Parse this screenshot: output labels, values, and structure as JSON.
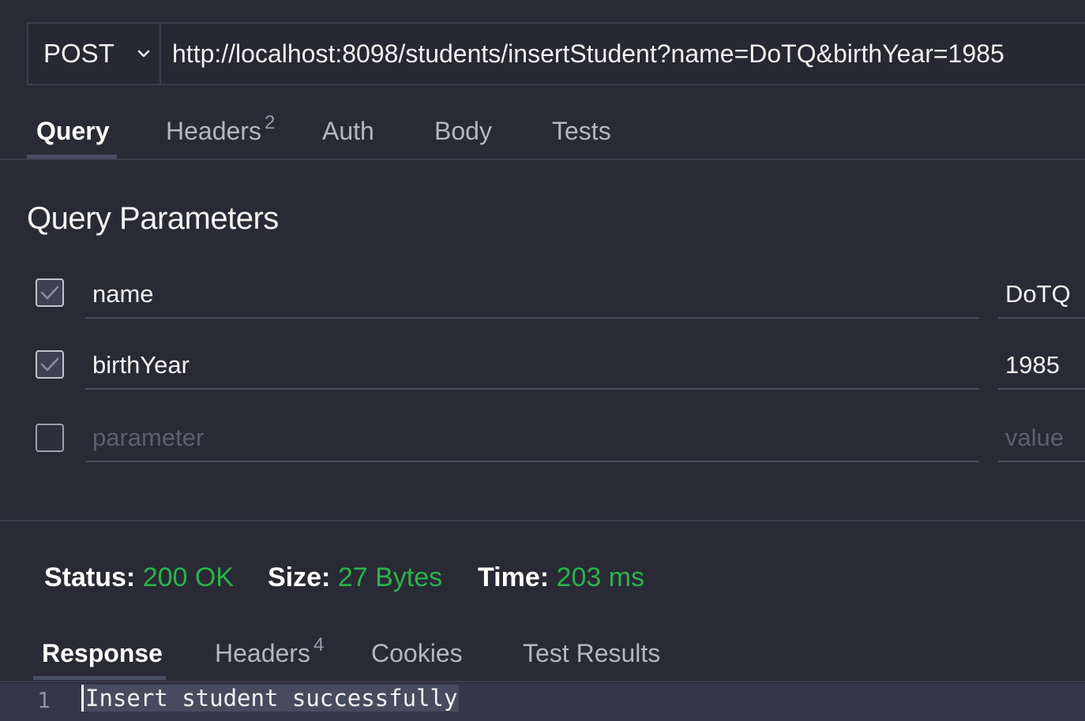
{
  "request": {
    "method": "POST",
    "url": "http://localhost:8098/students/insertStudent?name=DoTQ&birthYear=1985"
  },
  "request_tabs": [
    {
      "label": "Query",
      "active": true
    },
    {
      "label": "Headers",
      "count": "2"
    },
    {
      "label": "Auth"
    },
    {
      "label": "Body"
    },
    {
      "label": "Tests"
    }
  ],
  "query": {
    "title": "Query Parameters",
    "params": [
      {
        "name": "name",
        "value": "DoTQ",
        "checked": true
      },
      {
        "name": "birthYear",
        "value": "1985",
        "checked": true
      }
    ],
    "new_row": {
      "name_placeholder": "parameter",
      "value_placeholder": "value",
      "checked": false
    }
  },
  "status": {
    "status_label": "Status:",
    "status_value": "200 OK",
    "size_label": "Size:",
    "size_value": "27 Bytes",
    "time_label": "Time:",
    "time_value": "203 ms"
  },
  "response_tabs": [
    {
      "label": "Response",
      "active": true
    },
    {
      "label": "Headers",
      "count": "4"
    },
    {
      "label": "Cookies"
    },
    {
      "label": "Test Results"
    }
  ],
  "response": {
    "line_number": "1",
    "text": "Insert student successfully"
  },
  "colors": {
    "background": "#292a36",
    "success": "#2bb34a",
    "tab_underline": "#4a4e63"
  },
  "icons": {
    "method_dropdown": "chevron-down-icon",
    "checkbox_tick": "check-icon"
  }
}
